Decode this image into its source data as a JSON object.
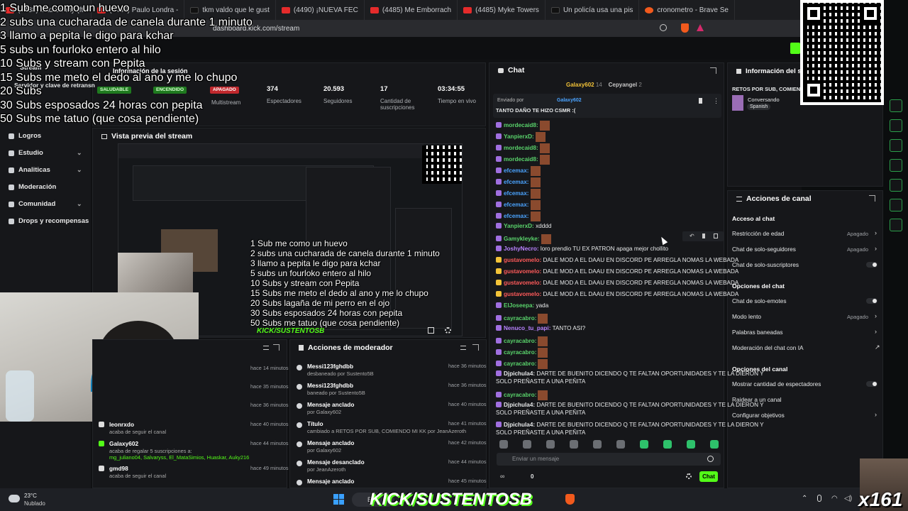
{
  "browser": {
    "tabs": [
      {
        "label": "(4488) Bad Bunny (ft.",
        "icon": "youtube-icon"
      },
      {
        "label": "(4485) Paulo Londra -",
        "icon": "youtube-icon"
      },
      {
        "label": "tkm valdo que le gust",
        "icon": "tiktok-icon"
      },
      {
        "label": "(4490) ¡NUEVA FEC",
        "icon": "youtube-icon"
      },
      {
        "label": "(4485) Me Emborrach",
        "icon": "youtube-icon"
      },
      {
        "label": "(4485) Myke Towers",
        "icon": "youtube-icon"
      },
      {
        "label": "Un policía usa una pis",
        "icon": "tiktok-icon"
      },
      {
        "label": "cronometro - Brave Se",
        "icon": "brave-icon"
      }
    ],
    "url": "dashboard.kick.com/stream"
  },
  "overlay_goals": [
    "1 Sub me como un huevo",
    "2 subs una cucharada de canela durante 1 minuto",
    "3 llamo a pepita  le digo para kchar",
    "5 subs un fourloko entero al hilo",
    "10 Subs y stream con Pepita",
    "15 Subs me meto el dedo al ano y me lo chupo",
    "20 Subs",
    "30 Subs esposados 24 horas con pepita",
    "50 Subs me tatuo (que cosa pendiente)"
  ],
  "preview_goals": [
    "1 Sub me como un huevo",
    "2 subs una cucharada de canela durante 1 minuto",
    "3 llamo a pepita  le digo para kchar",
    "5 subs un fourloko entero al hilo",
    "10 Subs y stream con Pepita",
    "15 Subs me meto el dedo al ano y me lo chupo",
    "20 Subs lagaña de mi perro en el ojo",
    "30 Subs esposados 24 horas con pepita",
    "50 Subs me tatuo (que cosa pendiente)"
  ],
  "session": {
    "title": "Información de la sesión",
    "stream_label": "Stream",
    "server_label": "Servidor y clave de retransn",
    "badges": {
      "healthy": "SALUDABLE",
      "on": "ENCENDIDO",
      "off": "APAGADO"
    },
    "multistream": "Multistream",
    "stats": [
      {
        "value": "374",
        "label": "Espectadores"
      },
      {
        "value": "20.593",
        "label": "Seguidores"
      },
      {
        "value": "17",
        "label": "Cantidad de suscripciones"
      },
      {
        "value": "03:34:55",
        "label": "Tiempo en vivo"
      }
    ]
  },
  "sidebar": {
    "items": [
      {
        "label": "Logros",
        "chevron": false
      },
      {
        "label": "Estudio",
        "chevron": true
      },
      {
        "label": "Analiticas",
        "chevron": true
      },
      {
        "label": "Moderación",
        "chevron": false
      },
      {
        "label": "Comunidad",
        "chevron": true
      },
      {
        "label": "Drops y recompensas",
        "chevron": false
      }
    ]
  },
  "preview": {
    "title": "Vista previa del stream",
    "watermark": "KICK/SUSTENTOSB"
  },
  "activity": {
    "items": [
      {
        "time": "hace 14 minutos"
      },
      {
        "time": "hace 35 minutos"
      },
      {
        "time": "hace 36 minutos"
      },
      {
        "user": "leonrxdo",
        "desc": "acaba de seguir el canal",
        "time": "hace 40 minutos"
      },
      {
        "user": "Galaxy602",
        "desc": "acaba de regalar 5 suscripciones a:",
        "recipients": "mg_juliano04, Salvaryss, El_MataSimios, Huaskar, Auky216",
        "time": "hace 44 minutos"
      },
      {
        "user": "gmd98",
        "desc": "acaba de seguir el canal",
        "time": "hace 49 minutos"
      }
    ]
  },
  "mod_actions": {
    "title": "Acciones de moderador",
    "items": [
      {
        "title": "Messi123fghdbb",
        "sub": "desbaneado por Sustento5B",
        "time": "hace 36 minutos"
      },
      {
        "title": "Messi123fghdbb",
        "sub": "baneado por Sustento5B",
        "time": "hace 36 minutos"
      },
      {
        "title": "Mensaje anclado",
        "sub": "por Galaxy602",
        "time": "hace 40 minutos"
      },
      {
        "title": "Título",
        "sub": "cambiado a RETOS POR SUB, COMIENDO MI KK por JeanAzeroth",
        "time": "hace 41 minutos"
      },
      {
        "title": "Mensaje anclado",
        "sub": "por Galaxy602",
        "time": "hace 42 minutos"
      },
      {
        "title": "Mensaje desanclado",
        "sub": "por JeanAzeroth",
        "time": "hace 44 minutos"
      },
      {
        "title": "Mensaje anclado",
        "sub": "",
        "time": "hace 45 minutos"
      }
    ]
  },
  "chat": {
    "title": "Chat",
    "top_users": [
      {
        "name": "Galaxy602",
        "count": "14"
      },
      {
        "name": "Cepyangel",
        "count": "2"
      }
    ],
    "pinned": {
      "by_label": "Enviado por",
      "user": "Galaxy602",
      "text": "TANTO DAÑO TE HIZO CSMR :("
    },
    "messages": [
      {
        "user": "mordecaid8:",
        "text": "",
        "emote": true,
        "color": "#59d36b"
      },
      {
        "user": "YanpierxD:",
        "text": "",
        "emote": true,
        "color": "#59d36b"
      },
      {
        "user": "mordecaid8:",
        "text": "",
        "emote": true,
        "color": "#59d36b"
      },
      {
        "user": "mordecaid8:",
        "text": "",
        "emote": true,
        "color": "#59d36b"
      },
      {
        "user": "efcemax:",
        "text": "",
        "emote": true,
        "color": "#4aa3ff"
      },
      {
        "user": "efcemax:",
        "text": "",
        "emote": true,
        "color": "#4aa3ff"
      },
      {
        "user": "efcemax:",
        "text": "",
        "emote": true,
        "color": "#4aa3ff"
      },
      {
        "user": "efcemax:",
        "text": "",
        "emote": true,
        "color": "#4aa3ff"
      },
      {
        "user": "efcemax:",
        "text": "",
        "emote": true,
        "color": "#4aa3ff"
      },
      {
        "user": "YanpierxD:",
        "text": "xdddd",
        "emote": false,
        "color": "#59d36b"
      },
      {
        "user": "Gamykleyke:",
        "text": "",
        "emote": true,
        "color": "#59d36b"
      },
      {
        "user": "JoshyNecro:",
        "text": "loro prendio TU EX PATRON apaga mejor chollito",
        "emote": false,
        "color": "#b882ff"
      },
      {
        "user": "gustavomelo:",
        "text": "DALE MOD A EL DAAU EN DISCORD PE ARREGLA NOMAS LA WEBADA",
        "emote": false,
        "color": "#ff5a5a"
      },
      {
        "user": "gustavomelo:",
        "text": "DALE MOD A EL DAAU EN DISCORD PE ARREGLA NOMAS LA WEBADA",
        "emote": false,
        "color": "#ff5a5a"
      },
      {
        "user": "gustavomelo:",
        "text": "DALE MOD A EL DAAU EN DISCORD PE ARREGLA NOMAS LA WEBADA",
        "emote": false,
        "color": "#ff5a5a"
      },
      {
        "user": "gustavomelo:",
        "text": "DALE MOD A EL DAAU EN DISCORD PE ARREGLA NOMAS LA WEBADA",
        "emote": false,
        "color": "#ff5a5a"
      },
      {
        "user": "ElJoseepa:",
        "text": "yada",
        "emote": false,
        "color": "#59d36b"
      },
      {
        "user": "cayracabro:",
        "text": "",
        "emote": true,
        "color": "#59d36b"
      },
      {
        "user": "Nenuco_tu_papi:",
        "text": "TANTO ASI?",
        "emote": false,
        "color": "#b882ff"
      },
      {
        "user": "cayracabro:",
        "text": "",
        "emote": true,
        "color": "#59d36b"
      },
      {
        "user": "cayracabro:",
        "text": "",
        "emote": true,
        "color": "#59d36b"
      },
      {
        "user": "cayracabro:",
        "text": "",
        "emote": true,
        "color": "#59d36b"
      },
      {
        "user": "Djpichula4:",
        "text": "DARTE DE BUENITO DICENDO Q TE FALTAN OPORTUNIDADES Y TE LA DIERON Y",
        "text2": "SOLO PREÑASTE A UNA PEÑITA",
        "emote": false,
        "color": "#e7e9ea"
      },
      {
        "user": "cayracabro:",
        "text": "",
        "emote": true,
        "color": "#59d36b"
      },
      {
        "user": "Djpichula4:",
        "text": "DARTE DE BUENITO DICENDO Q TE FALTAN OPORTUNIDADES Y TE LA DIERON Y",
        "text2": "SOLO PREÑASTE A UNA PEÑITA",
        "emote": false,
        "color": "#e7e9ea"
      },
      {
        "user": "Djpichula4:",
        "text": "DARTE DE BUENITO DICENDO Q TE FALTAN OPORTUNIDADES Y TE LA DIERON Y",
        "text2": "SOLO PREÑASTE A UNA PEÑITA",
        "emote": false,
        "color": "#e7e9ea"
      }
    ],
    "input_placeholder": "Enviar un mensaje",
    "points": "0",
    "send_label": "Chat"
  },
  "stream_info": {
    "title": "Información del s",
    "stream_title": "RETOS POR SUB, COMIENDO",
    "category": "Conversando",
    "language": "Spanish"
  },
  "channel_actions": {
    "title": "Acciones de canal",
    "sections": [
      {
        "heading": "Acceso al chat",
        "rows": [
          {
            "label": "Restricción de edad",
            "value": "Apagado",
            "control": "chevron"
          },
          {
            "label": "Chat de solo-seguidores",
            "value": "Apagado",
            "control": "chevron"
          },
          {
            "label": "Chat de solo-suscriptores",
            "value": "",
            "control": "toggle"
          }
        ]
      },
      {
        "heading": "Opciones del chat",
        "rows": [
          {
            "label": "Chat de solo-emotes",
            "value": "",
            "control": "toggle"
          },
          {
            "label": "Modo lento",
            "value": "Apagado",
            "control": "chevron"
          },
          {
            "label": "Palabras baneadas",
            "value": "",
            "control": "chevron"
          },
          {
            "label": "Moderación del chat con IA",
            "value": "",
            "control": "external"
          }
        ]
      },
      {
        "heading": "Opciones del canal",
        "rows": [
          {
            "label": "Mostrar cantidad de espectadores",
            "value": "",
            "control": "toggle"
          },
          {
            "label": "Raidear a un canal",
            "value": "",
            "control": "none"
          },
          {
            "label": "Configurar objetivos",
            "value": "",
            "control": "chevron"
          }
        ]
      }
    ]
  },
  "taskbar": {
    "temp": "23°C",
    "weather": "Nublado",
    "search": "Bu",
    "overlay_brand": "KICK/SUSTENTOSB"
  },
  "corner_badge": "x161",
  "colors": {
    "kick_green": "#53fc18",
    "badge_green": "#1f7a1f",
    "badge_red": "#c0282d"
  }
}
